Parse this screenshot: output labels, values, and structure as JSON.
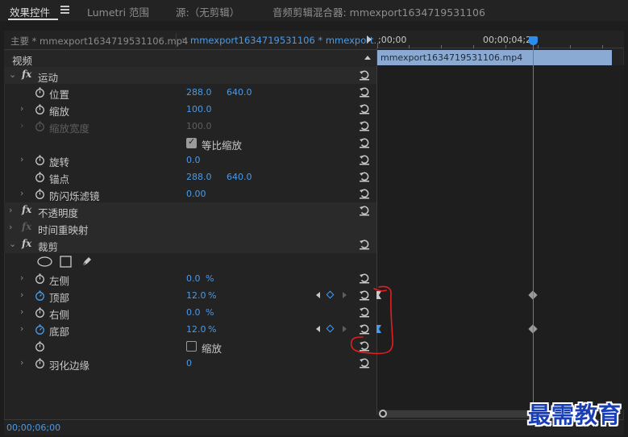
{
  "tabs": [
    {
      "label": "效果控件",
      "active": true
    },
    {
      "label": "Lumetri 范围",
      "active": false
    },
    {
      "label": "源:（无剪辑）",
      "active": false
    },
    {
      "label": "音频剪辑混合器: mmexport1634719531106",
      "active": false
    }
  ],
  "clip_tabs": {
    "master": "主要 * mmexport1634719531106.mp4",
    "clip": "mmexport1634719531106 * mmexport..."
  },
  "section_video": "视频",
  "effects": {
    "motion": {
      "label": "运动",
      "position": {
        "label": "位置",
        "x": "288.0",
        "y": "640.0"
      },
      "scale": {
        "label": "缩放",
        "value": "100.0"
      },
      "scale_width": {
        "label": "缩放宽度",
        "value": "100.0"
      },
      "uniform_scale": {
        "label": "等比缩放",
        "checked": true
      },
      "rotation": {
        "label": "旋转",
        "value": "0.0"
      },
      "anchor": {
        "label": "锚点",
        "x": "288.0",
        "y": "640.0"
      },
      "anti_flicker": {
        "label": "防闪烁滤镜",
        "value": "0.00"
      }
    },
    "opacity": {
      "label": "不透明度"
    },
    "time_remap": {
      "label": "时间重映射"
    },
    "crop": {
      "label": "裁剪",
      "left": {
        "label": "左侧",
        "value": "0.0",
        "unit": "%"
      },
      "top": {
        "label": "顶部",
        "value": "12.0",
        "unit": "%"
      },
      "right": {
        "label": "右侧",
        "value": "0.0",
        "unit": "%"
      },
      "bottom": {
        "label": "底部",
        "value": "12.0",
        "unit": "%"
      },
      "zoom": {
        "label": "缩放",
        "checked": false
      },
      "feather": {
        "label": "羽化边缘",
        "value": "0"
      }
    }
  },
  "timeline": {
    "start_tc": ";00;00",
    "playhead_tc": "00;00;04;29",
    "clip_name": "mmexport1634719531106.mp4"
  },
  "footer_timecode": "00;00;06;00",
  "watermark": "最需教育",
  "colors": {
    "accent": "#4c9ae6",
    "playhead": "#2d8ceb",
    "annotation": "#e02020",
    "watermark": "#1a3fb4"
  },
  "icons": [
    "menu-icon",
    "play-icon",
    "stopwatch-icon",
    "reset-icon",
    "ellipse-mask-icon",
    "rectangle-mask-icon",
    "pen-mask-icon",
    "keyframe-icon"
  ]
}
